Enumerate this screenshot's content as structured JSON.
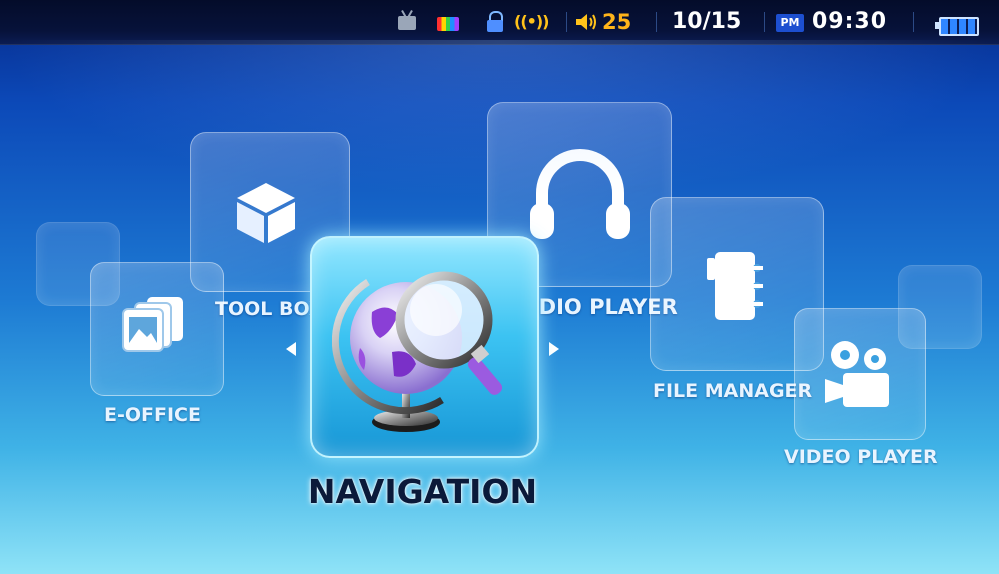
{
  "status_bar": {
    "icons": [
      "tv-icon",
      "color-icon",
      "lock-icon",
      "signal-icon",
      "speaker-icon",
      "battery-icon"
    ],
    "signal_text": "((•))",
    "volume": "25",
    "date": "10/15",
    "ampm": "PM",
    "time": "09:30"
  },
  "menu": {
    "e_office": "E-OFFICE",
    "tool_box": "TOOL BOX",
    "navigation": "NAVIGATION",
    "audio_player": "AUDIO PLAYER",
    "file_manager": "FILE MANAGER",
    "video_player": "VIDEO PLAYER"
  },
  "colors": {
    "accent": "#3cc3f2",
    "volume": "#ffb41a",
    "bg_top": "#062a8a",
    "bg_bottom": "#8fe3f7"
  }
}
